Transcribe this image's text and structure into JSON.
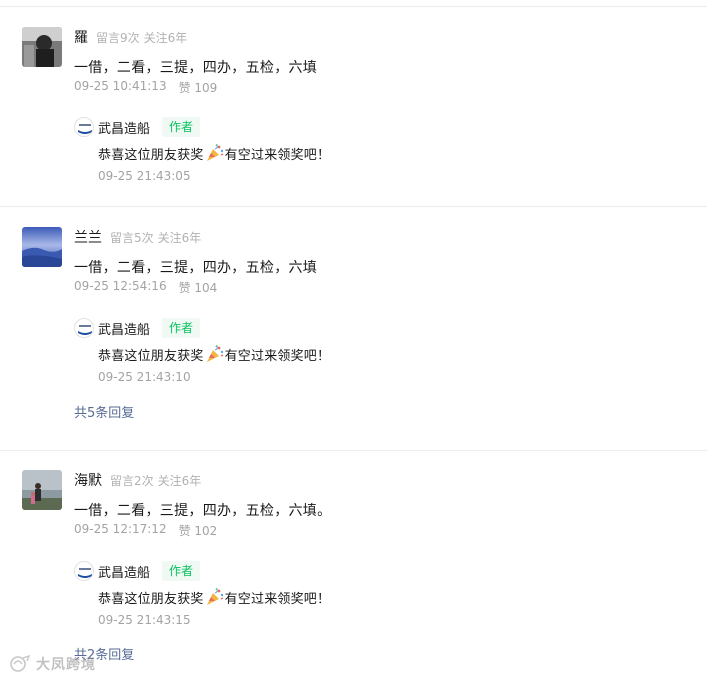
{
  "comments": [
    {
      "nickname": "羅",
      "meta_messages": "留言9次",
      "meta_follow": "关注6年",
      "content": "一借，二看，三提，四办，五检，六填",
      "time": "09-25 10:41:13",
      "likes": "赞 109",
      "reply": {
        "author": "武昌造船",
        "badge": "作者",
        "text_before": "恭喜这位朋友获奖",
        "text_after": "有空过来领奖吧！",
        "time": "09-25 21:43:05"
      }
    },
    {
      "nickname": "兰兰",
      "meta_messages": "留言5次",
      "meta_follow": "关注6年",
      "content": "一借，二看，三提，四办，五检，六填",
      "time": "09-25 12:54:16",
      "likes": "赞 104",
      "reply": {
        "author": "武昌造船",
        "badge": "作者",
        "text_before": "恭喜这位朋友获奖",
        "text_after": "有空过来领奖吧！",
        "time": "09-25 21:43:10"
      },
      "more_replies": "共5条回复"
    },
    {
      "nickname": "海默",
      "meta_messages": "留言2次",
      "meta_follow": "关注6年",
      "content": "一借，二看，三提，四办，五检，六填。",
      "time": "09-25 12:17:12",
      "likes": "赞 102",
      "reply": {
        "author": "武昌造船",
        "badge": "作者",
        "text_before": "恭喜这位朋友获奖",
        "text_after": "有空过来领奖吧！",
        "time": "09-25 21:43:15"
      },
      "more_replies": "共2条回复"
    }
  ],
  "watermark": {
    "text": "大凤跨境"
  },
  "icons": {
    "reply_avatar": "wuchang-shipbuilding-logo-icon",
    "emoji": "party-popper-icon"
  },
  "colors": {
    "link": "#576b95",
    "author_badge": "#07c160",
    "meta": "#b2b2b2"
  }
}
